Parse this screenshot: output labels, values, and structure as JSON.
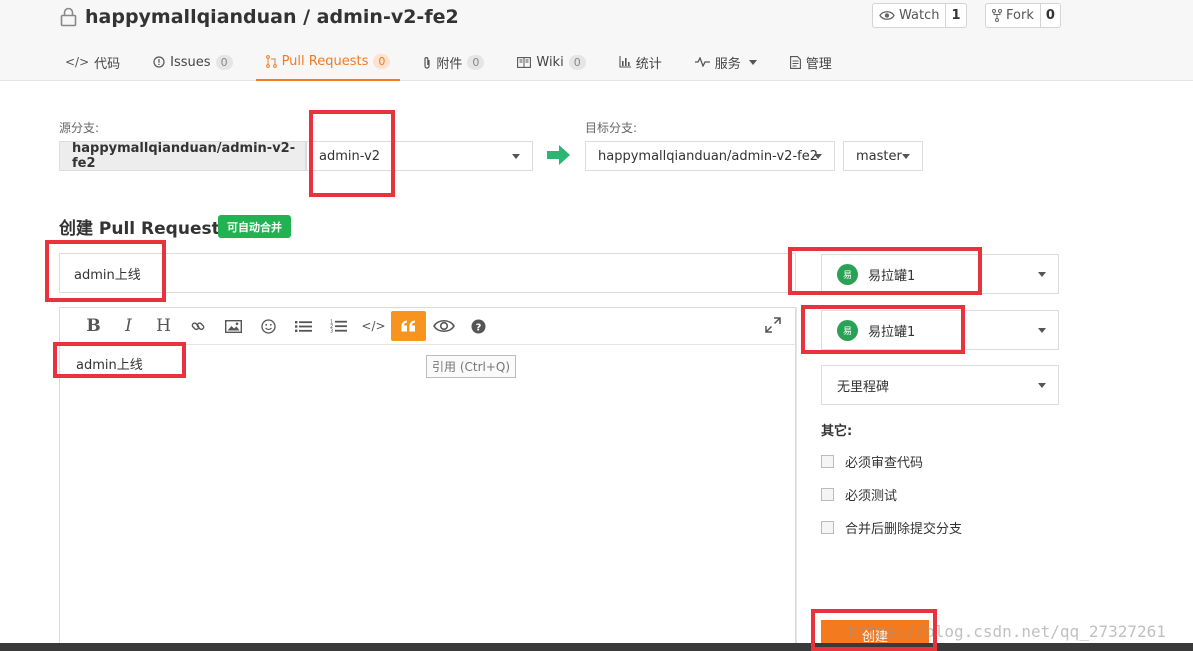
{
  "repo": {
    "title": "happymallqianduan / admin-v2-fe2"
  },
  "header_buttons": {
    "watch": {
      "label": "Watch",
      "count": "1"
    },
    "fork": {
      "label": "Fork",
      "count": "0"
    }
  },
  "tabs": [
    {
      "label": "代码"
    },
    {
      "label": "Issues",
      "count": "0"
    },
    {
      "label": "Pull Requests",
      "count": "0"
    },
    {
      "label": "附件",
      "count": "0"
    },
    {
      "label": "Wiki",
      "count": "0"
    },
    {
      "label": "统计"
    },
    {
      "label": "服务"
    },
    {
      "label": "管理"
    }
  ],
  "source": {
    "label": "源分支:",
    "repo": "happymallqianduan/admin-v2-fe2",
    "branch": "admin-v2"
  },
  "target": {
    "label": "目标分支:",
    "repo": "happymallqianduan/admin-v2-fe2",
    "branch": "master"
  },
  "pr": {
    "heading": "创建 Pull Request",
    "merge_badge": "可自动合并",
    "title_value": "admin上线",
    "body_value": "admin上线",
    "tooltip": "引用 (Ctrl+Q)"
  },
  "sidebar": {
    "assignee": {
      "avatar_text": "易",
      "name": "易拉罐1"
    },
    "reviewer": {
      "avatar_text": "易",
      "name": "易拉罐1"
    },
    "milestone": "无里程碑",
    "other_label": "其它:",
    "options": [
      "必须审查代码",
      "必须测试",
      "合并后删除提交分支"
    ],
    "create_label": "创建"
  },
  "watermark": "https://blog.csdn.net/qq_27327261",
  "colors": {
    "accent": "#f47a20",
    "merge_green": "#21b351",
    "highlight_red": "#e8323c"
  }
}
